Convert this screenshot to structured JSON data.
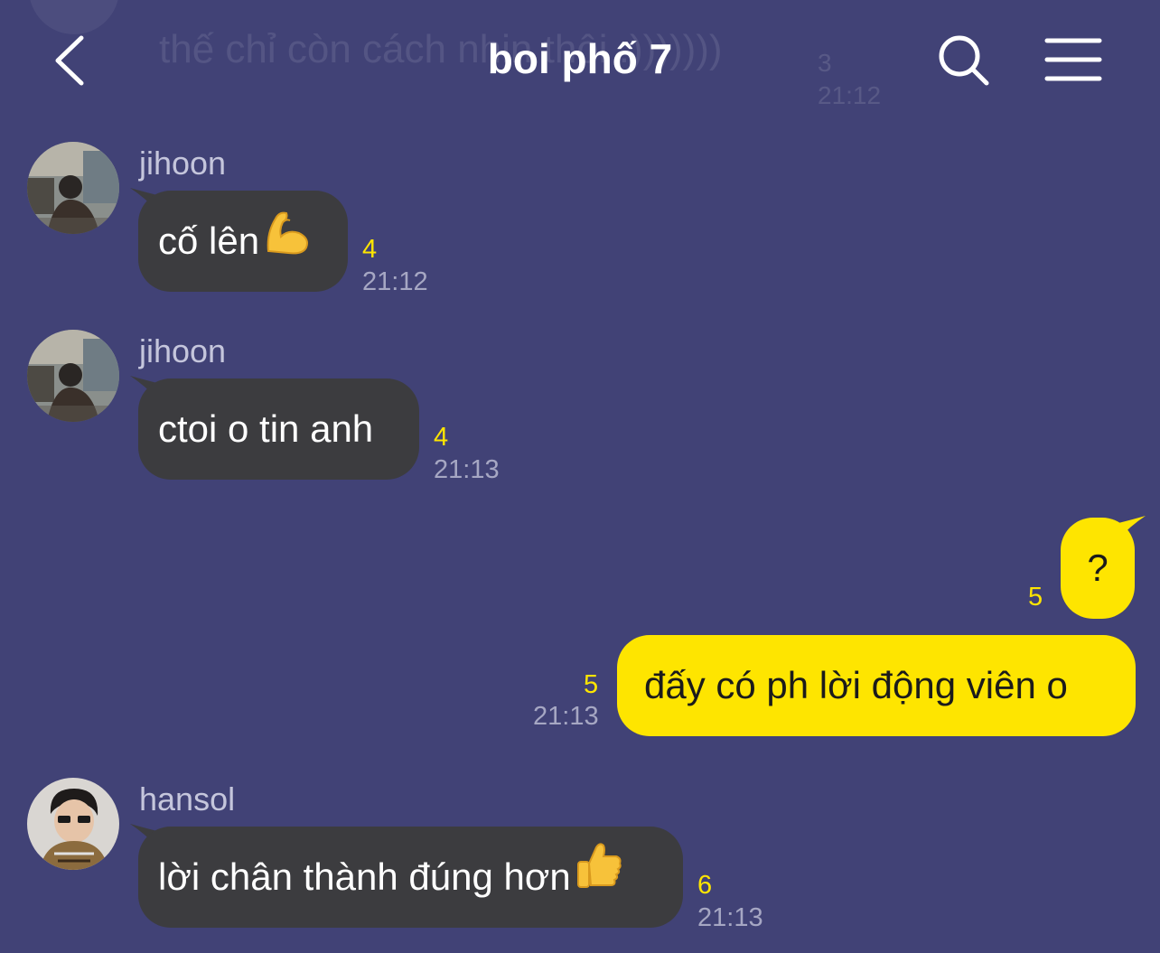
{
  "header": {
    "title": "boi phố 7",
    "back_icon": "chevron-left-icon",
    "search_icon": "search-icon",
    "menu_icon": "hamburger-menu-icon"
  },
  "ghost_message": {
    "text": "thế chỉ còn cách nhịn thôi :)))))))",
    "count": "3",
    "time": "21:12"
  },
  "messages": [
    {
      "sender": "jihoon",
      "direction": "incoming",
      "text": "cố lên",
      "emoji": "flexed-biceps-icon",
      "count": "4",
      "time": "21:12"
    },
    {
      "sender": "jihoon",
      "direction": "incoming",
      "text": "ctoi o tin anh",
      "count": "4",
      "time": "21:13"
    },
    {
      "direction": "outgoing",
      "text": "?",
      "count": "5"
    },
    {
      "direction": "outgoing",
      "text": "đấy có ph lời động viên o",
      "count": "5",
      "time": "21:13"
    },
    {
      "sender": "hansol",
      "direction": "incoming",
      "text": "lời chân thành đúng hơn",
      "emoji": "thumbs-up-icon",
      "count": "6",
      "time": "21:13"
    }
  ],
  "colors": {
    "background": "#414276",
    "incoming_bubble": "#3c3c3f",
    "outgoing_bubble": "#fee500",
    "read_count": "#fee500",
    "timestamp": "#a6a7c3"
  }
}
